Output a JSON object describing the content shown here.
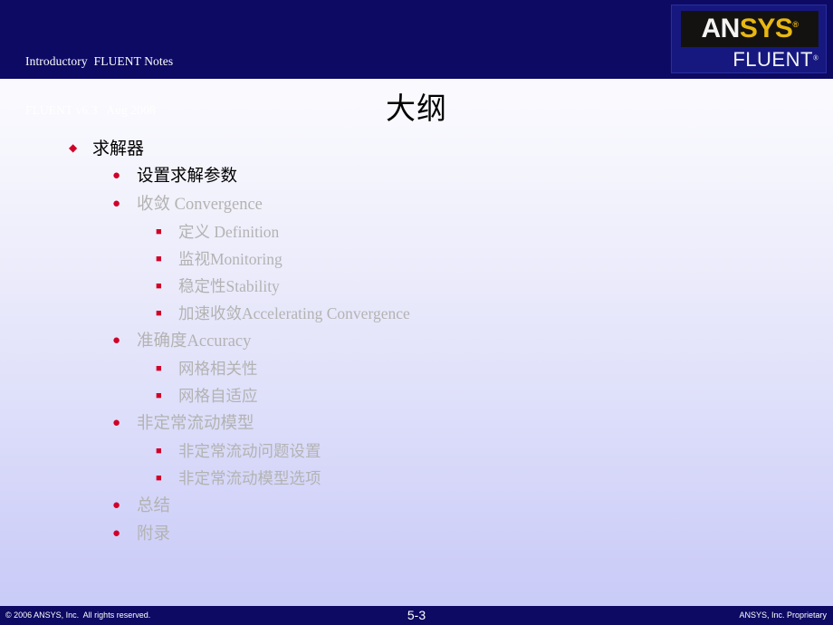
{
  "header": {
    "line1": "Introductory  FLUENT Notes",
    "line2": "FLUENT v6.3   Aug 2008",
    "background_color": "#0d0a63"
  },
  "logo": {
    "brand_part1": "AN",
    "brand_part2": "SYS",
    "registered_mark_1": "®",
    "product": "FLUENT",
    "registered_mark_2": "®",
    "plate_color": "#141210",
    "brand_part1_color": "#f4f4f4",
    "brand_part2_color": "#e8b712",
    "product_color": "#f2f2f2"
  },
  "title": {
    "text": "大纲"
  },
  "outline": {
    "bullet_color": "#d00028",
    "active_text_color": "#000000",
    "muted_text_color": "#b3b3b3",
    "items": [
      {
        "level": 1,
        "marker": "diamond-bullet",
        "glyph": "◆",
        "label": "求解器",
        "state": "active"
      },
      {
        "level": 2,
        "marker": "disc-bullet",
        "glyph": "●",
        "label": "设置求解参数",
        "state": "active"
      },
      {
        "level": 2,
        "marker": "disc-bullet",
        "glyph": "●",
        "label": "收敛 Convergence",
        "state": "muted"
      },
      {
        "level": 3,
        "marker": "square-bullet",
        "glyph": "■",
        "label": "定义 Definition",
        "state": "muted"
      },
      {
        "level": 3,
        "marker": "square-bullet",
        "glyph": "■",
        "label": "监视Monitoring",
        "state": "muted"
      },
      {
        "level": 3,
        "marker": "square-bullet",
        "glyph": "■",
        "label": "稳定性Stability",
        "state": "muted"
      },
      {
        "level": 3,
        "marker": "square-bullet",
        "glyph": "■",
        "label": "加速收敛Accelerating  Convergence",
        "state": "muted"
      },
      {
        "level": 2,
        "marker": "disc-bullet",
        "glyph": "●",
        "label": "准确度Accuracy",
        "state": "muted"
      },
      {
        "level": 3,
        "marker": "square-bullet",
        "glyph": "■",
        "label": "网格相关性",
        "state": "muted"
      },
      {
        "level": 3,
        "marker": "square-bullet",
        "glyph": "■",
        "label": "网格自适应",
        "state": "muted"
      },
      {
        "level": 2,
        "marker": "disc-bullet",
        "glyph": "●",
        "label": "非定常流动模型",
        "state": "muted"
      },
      {
        "level": 3,
        "marker": "square-bullet",
        "glyph": "■",
        "label": "非定常流动问题设置",
        "state": "muted"
      },
      {
        "level": 3,
        "marker": "square-bullet",
        "glyph": "■",
        "label": "非定常流动模型选项",
        "state": "muted"
      },
      {
        "level": 2,
        "marker": "disc-bullet",
        "glyph": "●",
        "label": "总结",
        "state": "muted"
      },
      {
        "level": 2,
        "marker": "disc-bullet",
        "glyph": "●",
        "label": "附录",
        "state": "muted"
      }
    ]
  },
  "footer": {
    "copyright": "© 2006 ANSYS, Inc.  All rights reserved.",
    "page_number": "5-3",
    "proprietary": "ANSYS, Inc. Proprietary",
    "background_color": "#0d0a63"
  }
}
